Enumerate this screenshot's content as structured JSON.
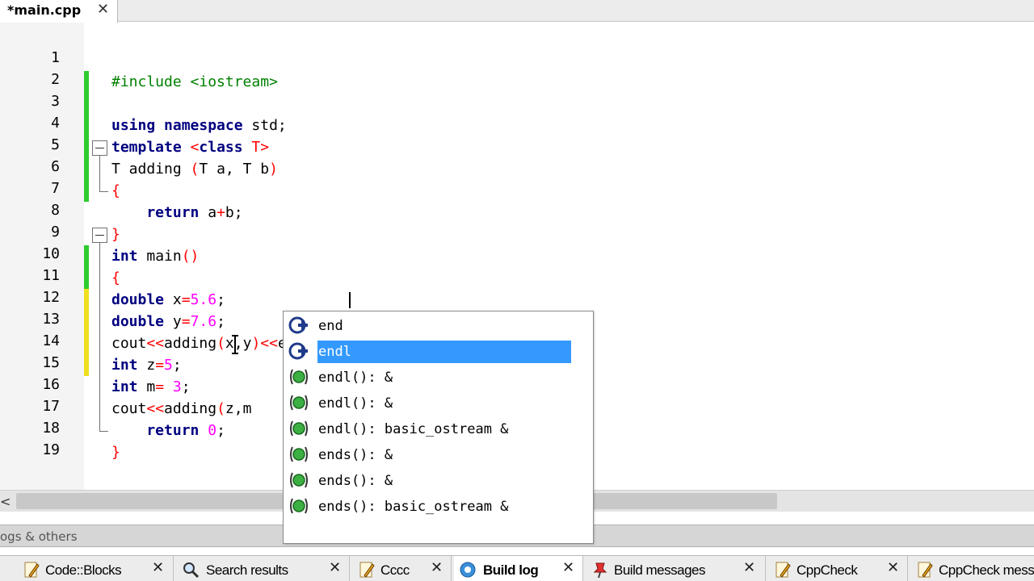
{
  "editor_tab": {
    "label": "*main.cpp",
    "close_glyph": "✕"
  },
  "code_lines": [
    {
      "num": "1"
    },
    {
      "num": "2"
    },
    {
      "num": "3"
    },
    {
      "num": "4"
    },
    {
      "num": "5"
    },
    {
      "num": "6"
    },
    {
      "num": "7"
    },
    {
      "num": "8"
    },
    {
      "num": "9"
    },
    {
      "num": "10"
    },
    {
      "num": "11"
    },
    {
      "num": "12"
    },
    {
      "num": "13"
    },
    {
      "num": "14"
    },
    {
      "num": "15"
    },
    {
      "num": "16"
    },
    {
      "num": "17"
    },
    {
      "num": "18"
    },
    {
      "num": "19"
    }
  ],
  "code": {
    "l1_a": "#include",
    "l1_b": " <iostream>",
    "l3_a": "using namespace",
    "l3_b": " std;",
    "l4_a": "template",
    "l4_b": " <",
    "l4_c": "class",
    "l4_d": " T>",
    "l5_a": "T adding ",
    "l5_b": "(",
    "l5_c": "T a, T b",
    "l5_d": ")",
    "l6_a": "{",
    "l7_a": "    return",
    "l7_b": " a",
    "l7_c": "+",
    "l7_d": "b;",
    "l8_a": "}",
    "l9_a": "int",
    "l9_b": " main",
    "l9_c": "()",
    "l10_a": "{",
    "l11_a": "double",
    "l11_b": " x",
    "l11_c": "=",
    "l11_d": "5.6",
    "l11_e": ";",
    "l12_a": "double",
    "l12_b": " y",
    "l12_c": "=",
    "l12_d": "7.6",
    "l12_e": ";",
    "l13_a": "cout",
    "l13_b": "<<",
    "l13_c": "adding",
    "l13_d": "(",
    "l13_e": "x,y",
    "l13_f": ")",
    "l13_g": "<<",
    "l13_h": "endl",
    "l14_a": "int",
    "l14_b": " z",
    "l14_c": "=",
    "l14_d": "5",
    "l14_e": ";",
    "l15_a": "int",
    "l15_b": " m",
    "l15_c": "=",
    "l15_d": " 3",
    "l15_e": ";",
    "l16_a": "cout",
    "l16_b": "<<",
    "l16_c": "adding",
    "l16_d": "(",
    "l16_e": "z,m",
    "l17_a": "    return",
    "l17_b": " 0",
    "l17_c": ";",
    "l18_a": "}"
  },
  "autocomplete": {
    "items": [
      {
        "label": "end",
        "icon": "class-icon"
      },
      {
        "label": "endl",
        "icon": "class-icon"
      },
      {
        "label": "endl(): &",
        "icon": "function-icon"
      },
      {
        "label": "endl(): &",
        "icon": "function-icon"
      },
      {
        "label": "endl(): basic_ostream &",
        "icon": "function-icon"
      },
      {
        "label": "ends(): &",
        "icon": "function-icon"
      },
      {
        "label": "ends(): &",
        "icon": "function-icon"
      },
      {
        "label": "ends(): basic_ostream &",
        "icon": "function-icon"
      }
    ],
    "selected_index": 1
  },
  "scrollbar": {
    "left_arrow": "<"
  },
  "logs_pane": {
    "title": "ogs & others"
  },
  "bottom_tabs": [
    {
      "label": "Code::Blocks",
      "icon": "pencil-icon",
      "close": "✕"
    },
    {
      "label": "Search results",
      "icon": "search-icon",
      "close": "✕"
    },
    {
      "label": "Cccc",
      "icon": "pencil-icon",
      "close": "✕"
    },
    {
      "label": "Build log",
      "icon": "gear-icon",
      "close": "✕"
    },
    {
      "label": "Build messages",
      "icon": "pin-icon",
      "close": "✕"
    },
    {
      "label": "CppCheck",
      "icon": "pencil-icon",
      "close": "✕"
    },
    {
      "label": "CppCheck messa",
      "icon": "pencil-icon",
      "close": ""
    }
  ],
  "colors": {
    "keyword": "#000080",
    "preprocessor": "#008000",
    "number": "#ff00ff",
    "operator": "#ff0000",
    "changed_saved": "#2ecc2e",
    "changed_unsaved": "#f0e020",
    "selection": "#3399ff"
  }
}
